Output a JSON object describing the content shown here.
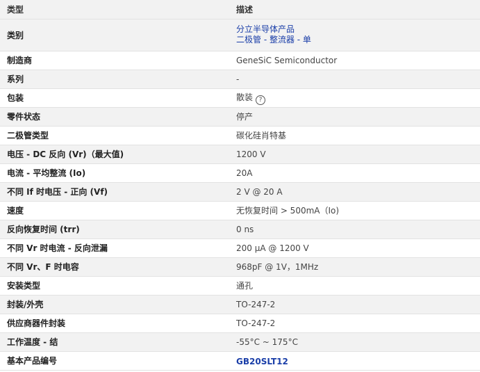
{
  "header": {
    "type_label": "类型",
    "desc_label": "描述"
  },
  "rows": {
    "category": {
      "label": "类别",
      "links": [
        "分立半导体产品",
        "二极管 - 整流器 - 单"
      ]
    },
    "manufacturer": {
      "label": "制造商",
      "value": "GeneSiC Semiconductor"
    },
    "series": {
      "label": "系列",
      "value": "-"
    },
    "packaging": {
      "label": "包装",
      "value": "散装",
      "help_icon": "?"
    },
    "part_status": {
      "label": "零件状态",
      "value": "停产"
    },
    "diode_type": {
      "label": "二极管类型",
      "value": "碳化硅肖特基"
    },
    "vr": {
      "label": "电压 - DC 反向 (Vr)（最大值)",
      "value": "1200 V"
    },
    "io": {
      "label": "电流 - 平均整流 (Io)",
      "value": "20A"
    },
    "vf": {
      "label": "不同 If 时电压 - 正向 (Vf)",
      "value": "2 V @ 20 A"
    },
    "speed": {
      "label": "速度",
      "value": "无恢复时间 > 500mA（Io)"
    },
    "trr": {
      "label": "反向恢复时间 (trr)",
      "value": "0 ns"
    },
    "leakage": {
      "label": "不同 Vr 时电流 - 反向泄漏",
      "value": "200 µA @ 1200 V"
    },
    "capacitance": {
      "label": "不同 Vr、F 时电容",
      "value": "968pF @ 1V，1MHz"
    },
    "mounting": {
      "label": "安装类型",
      "value": "通孔"
    },
    "package": {
      "label": "封装/外壳",
      "value": "TO-247-2"
    },
    "supplier_package": {
      "label": "供应商器件封装",
      "value": "TO-247-2"
    },
    "op_temp": {
      "label": "工作温度 - 结",
      "value": "-55°C ~ 175°C"
    },
    "base_part": {
      "label": "基本产品编号",
      "value": "GB20SLT12"
    }
  }
}
